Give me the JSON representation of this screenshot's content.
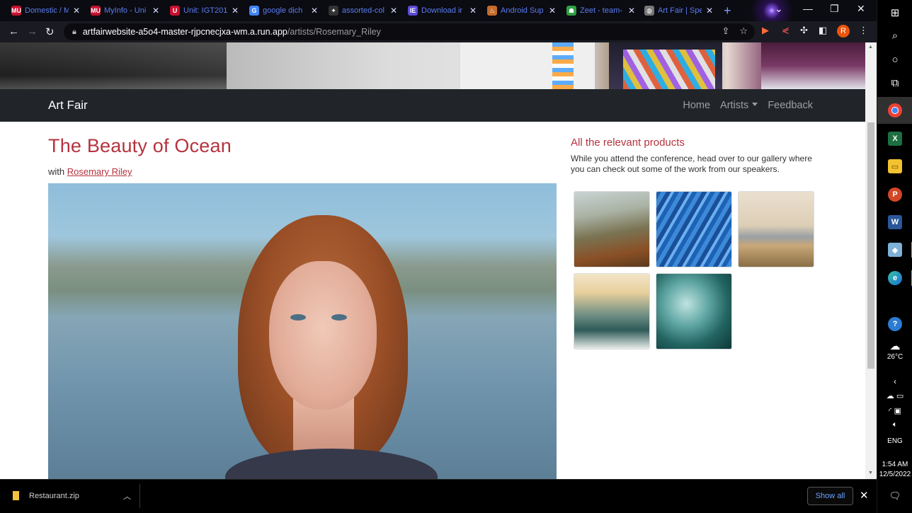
{
  "browser": {
    "tabs": [
      {
        "title": "Domestic / M",
        "favicon": "MU",
        "color": "#c8102e"
      },
      {
        "title": "MyInfo - Uni",
        "favicon": "MU",
        "color": "#c8102e"
      },
      {
        "title": "Unit: IGT201",
        "favicon": "U",
        "color": "#c8102e"
      },
      {
        "title": "google dịch",
        "favicon": "G",
        "color": "#4285f4"
      },
      {
        "title": "assorted-col",
        "favicon": "✦",
        "color": "#333333"
      },
      {
        "title": "Download ir",
        "favicon": "IE",
        "color": "#5b4bd4"
      },
      {
        "title": "Android Sup",
        "favicon": "♨",
        "color": "#c46b2c"
      },
      {
        "title": "Zeet - team-",
        "favicon": "☗",
        "color": "#2ea043"
      },
      {
        "title": "Art Fair | Spe",
        "favicon": "◍",
        "color": "#777777"
      }
    ],
    "url_host": "artfairwebsite-a5o4-master-rjpcnecjxa-wm.a.run.app",
    "url_path": "/artists/Rosemary_Riley",
    "profile_initial": "R"
  },
  "navbar": {
    "brand": "Art Fair",
    "links": {
      "home": "Home",
      "artists": "Artists",
      "feedback": "Feedback"
    }
  },
  "main": {
    "title": "The Beauty of Ocean",
    "byline_prefix": "with",
    "artist_name": "Rosemary Riley"
  },
  "sidebar": {
    "title": "All the relevant products",
    "text": "While you attend the conference, head over to our gallery where you can check out some of the work from our speakers.",
    "products": [
      {
        "name": "mountain-landscape-painting"
      },
      {
        "name": "blue-brushstroke-painting"
      },
      {
        "name": "coastal-landscape-painting"
      },
      {
        "name": "ocean-wave-sunset-photo"
      },
      {
        "name": "teal-wave-photo"
      }
    ]
  },
  "downloads": {
    "file_name": "Restaurant.zip",
    "show_all": "Show all"
  },
  "taskbar": {
    "weather": "26°C",
    "language": "ENG",
    "time": "1:54 AM",
    "date": "12/5/2022"
  }
}
